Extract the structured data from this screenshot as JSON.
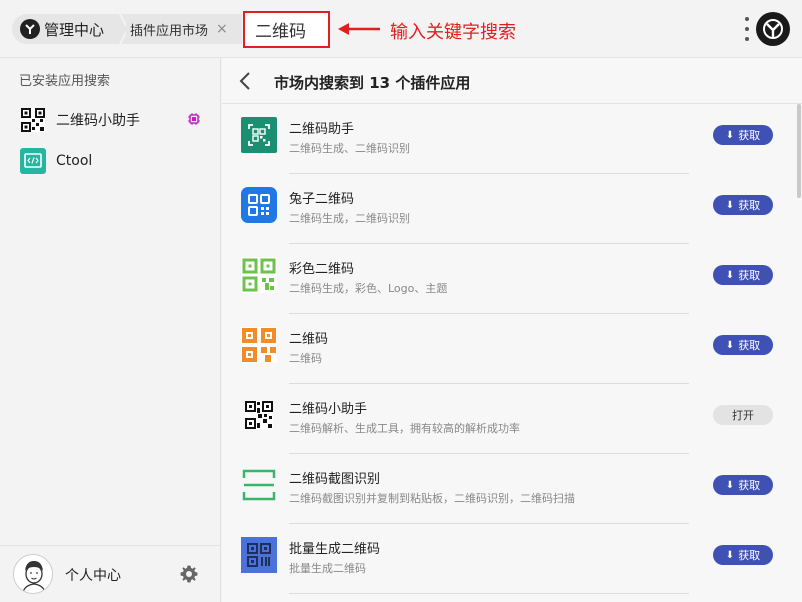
{
  "topbar": {
    "home_label": "管理中心",
    "plugin_tab_label": "插件应用市场",
    "search_value": "二维码",
    "annotation_text": "输入关键字搜索",
    "annotation_color": "#e02020"
  },
  "sidebar": {
    "title": "已安装应用搜索",
    "items": [
      {
        "label": "二维码小助手",
        "icon": "qr-helper-icon"
      },
      {
        "label": "Ctool",
        "icon": "ctool-icon"
      }
    ],
    "footer_label": "个人中心"
  },
  "main": {
    "title": "市场内搜索到 13 个插件应用",
    "get_label": "获取",
    "open_label": "打开",
    "accent_color": "#3f51b5",
    "results": [
      {
        "name": "二维码助手",
        "desc": "二维码生成、二维码识别",
        "action": "获取",
        "icon": "qr-assistant-icon"
      },
      {
        "name": "兔子二维码",
        "desc": "二维码生成，二维码识别",
        "action": "获取",
        "icon": "rabbit-qr-icon"
      },
      {
        "name": "彩色二维码",
        "desc": "二维码生成，彩色、Logo、主题",
        "action": "获取",
        "icon": "color-qr-icon"
      },
      {
        "name": "二维码",
        "desc": "二维码",
        "action": "获取",
        "icon": "orange-qr-icon"
      },
      {
        "name": "二维码小助手",
        "desc": "二维码解析、生成工具，拥有较高的解析成功率",
        "action": "打开",
        "icon": "qr-helper-icon"
      },
      {
        "name": "二维码截图识别",
        "desc": "二维码截图识别并复制到粘贴板，二维码识别，二维码扫描",
        "action": "获取",
        "icon": "qr-scan-icon"
      },
      {
        "name": "批量生成二维码",
        "desc": "批量生成二维码",
        "action": "获取",
        "icon": "batch-qr-icon"
      }
    ]
  }
}
